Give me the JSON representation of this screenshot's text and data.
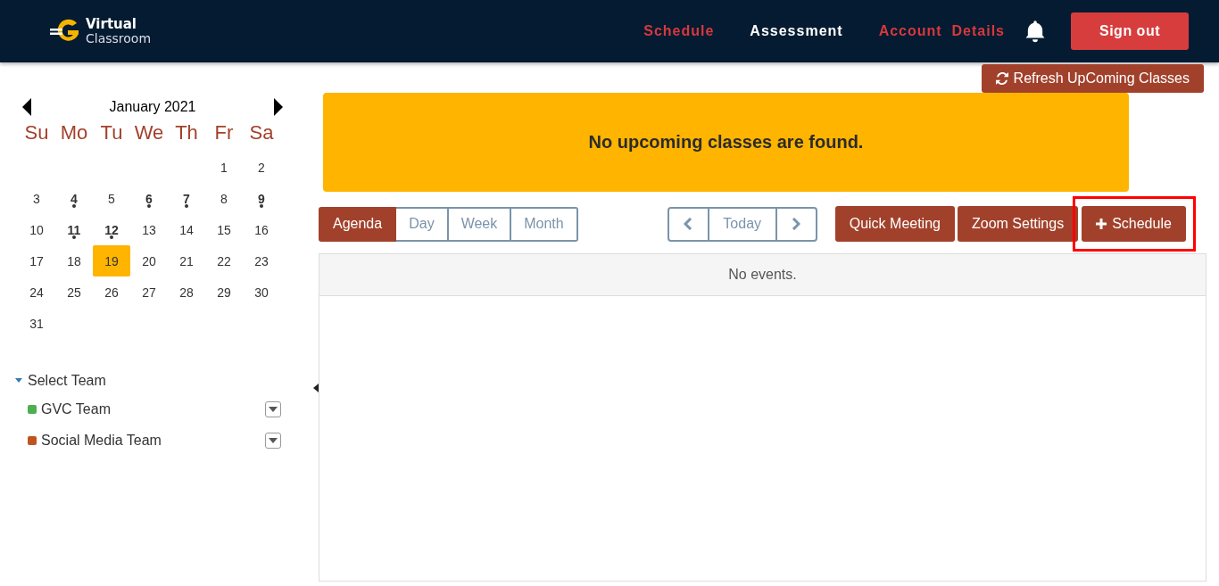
{
  "header": {
    "logo": {
      "line1": "Virtual",
      "line2": "Classroom"
    },
    "nav": [
      {
        "label": "Schedule",
        "selected": false
      },
      {
        "label": "Assessment",
        "selected": true
      },
      {
        "label": "Account  Details",
        "selected": false
      }
    ],
    "sign_out": "Sign out"
  },
  "refresh_button": "Refresh UpComing Classes",
  "calendar": {
    "month": "January 2021",
    "weekdays": [
      "Su",
      "Mo",
      "Tu",
      "We",
      "Th",
      "Fr",
      "Sa"
    ],
    "weeks": [
      [
        {
          "day": "1",
          "has_events": false,
          "selected": false
        },
        {
          "day": "2",
          "has_events": false,
          "selected": false
        }
      ],
      [
        {
          "day": "3",
          "has_events": false,
          "selected": false
        },
        {
          "day": "4",
          "has_events": true,
          "selected": false
        },
        {
          "day": "5",
          "has_events": false,
          "selected": false
        },
        {
          "day": "6",
          "has_events": true,
          "selected": false
        },
        {
          "day": "7",
          "has_events": true,
          "selected": false
        },
        {
          "day": "8",
          "has_events": false,
          "selected": false
        },
        {
          "day": "9",
          "has_events": true,
          "selected": false
        }
      ],
      [
        {
          "day": "10",
          "has_events": false,
          "selected": false
        },
        {
          "day": "11",
          "has_events": true,
          "selected": false
        },
        {
          "day": "12",
          "has_events": true,
          "selected": false
        },
        {
          "day": "13",
          "has_events": false,
          "selected": false
        },
        {
          "day": "14",
          "has_events": false,
          "selected": false
        },
        {
          "day": "15",
          "has_events": false,
          "selected": false
        },
        {
          "day": "16",
          "has_events": false,
          "selected": false
        }
      ],
      [
        {
          "day": "17",
          "has_events": false,
          "selected": false
        },
        {
          "day": "18",
          "has_events": false,
          "selected": false
        },
        {
          "day": "19",
          "has_events": false,
          "selected": true
        },
        {
          "day": "20",
          "has_events": false,
          "selected": false
        },
        {
          "day": "21",
          "has_events": false,
          "selected": false
        },
        {
          "day": "22",
          "has_events": false,
          "selected": false
        },
        {
          "day": "23",
          "has_events": false,
          "selected": false
        }
      ],
      [
        {
          "day": "24",
          "has_events": false,
          "selected": false
        },
        {
          "day": "25",
          "has_events": false,
          "selected": false
        },
        {
          "day": "26",
          "has_events": false,
          "selected": false
        },
        {
          "day": "27",
          "has_events": false,
          "selected": false
        },
        {
          "day": "28",
          "has_events": false,
          "selected": false
        },
        {
          "day": "29",
          "has_events": false,
          "selected": false
        },
        {
          "day": "30",
          "has_events": false,
          "selected": false
        }
      ],
      [
        {
          "day": "31",
          "has_events": false,
          "selected": false
        }
      ]
    ]
  },
  "teams": {
    "label": "Select Team",
    "expanded": true,
    "items": [
      {
        "name": "GVC Team",
        "color": "#4caf50"
      },
      {
        "name": "Social Media Team",
        "color": "#c0541e"
      }
    ]
  },
  "alert": "No upcoming classes are found.",
  "views": [
    {
      "label": "Agenda",
      "selected": true
    },
    {
      "label": "Day",
      "selected": false
    },
    {
      "label": "Week",
      "selected": false
    },
    {
      "label": "Month",
      "selected": false
    }
  ],
  "today_button": "Today",
  "actions": [
    {
      "label": "Quick Meeting",
      "kind": "plain",
      "highlighted": false
    },
    {
      "label": "Zoom Settings",
      "kind": "plain",
      "highlighted": false
    },
    {
      "label": "Schedule",
      "kind": "add",
      "highlighted": true
    }
  ],
  "events": {
    "message": "No events."
  }
}
